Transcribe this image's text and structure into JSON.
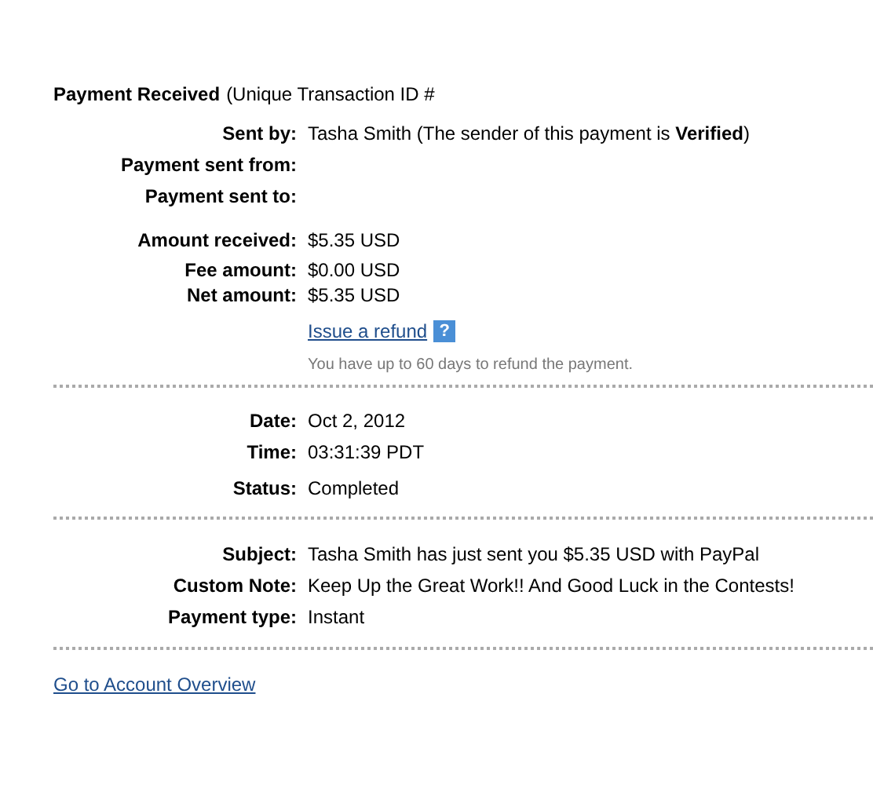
{
  "heading": {
    "title": "Payment Received",
    "suffix": "(Unique Transaction ID #"
  },
  "sections": [
    {
      "rows": [
        {
          "label": "Sent by:",
          "value": "Tasha Smith (The sender of this payment is **Verified**)"
        },
        {
          "label": "Payment sent from:"
        },
        {
          "label": "Payment sent to:"
        },
        {
          "label": "Amount received:",
          "value": "$5.35 USD"
        },
        {
          "label": "Fee amount:",
          "value": "$0.00 USD"
        },
        {
          "label": "Net amount:",
          "value": "$5.35 USD"
        }
      ],
      "refund": {
        "link": "Issue a refund",
        "help": "?",
        "note": "You have up to 60 days to refund the payment."
      }
    },
    {
      "rows": [
        {
          "label": "Date:",
          "value": "Oct 2, 2012"
        },
        {
          "label": "Time:",
          "value": "03:31:39 PDT"
        },
        {
          "label": "Status:",
          "value": "Completed"
        }
      ]
    },
    {
      "rows": [
        {
          "label": "Subject:",
          "value": "Tasha Smith has just sent you $5.35 USD with PayPal"
        },
        {
          "label": "Custom Note:",
          "value": "Keep Up the Great Work!! And Good Luck in the Contests!"
        },
        {
          "label": "Payment type:",
          "value": "Instant"
        }
      ]
    }
  ],
  "footer_link": "Go to Account Overview"
}
